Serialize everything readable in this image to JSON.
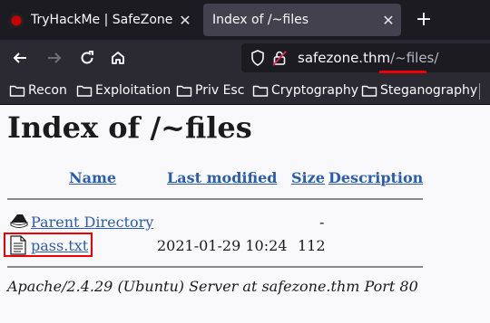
{
  "tabs": [
    {
      "title": "TryHackMe | SafeZone",
      "close": "✕",
      "active": false
    },
    {
      "title": "Index of /~files",
      "close": "✕",
      "active": true
    }
  ],
  "new_tab": "+",
  "toolbar": {
    "url_host": "safezone.thm",
    "url_path": "/~files/"
  },
  "bookmarks": [
    "Recon",
    "Exploitation",
    "Priv Esc",
    "Cryptography",
    "Steganography"
  ],
  "page": {
    "heading": "Index of /~files",
    "columns": {
      "name": "Name",
      "last_modified": "Last modified",
      "size": "Size",
      "description": "Description"
    },
    "rows": [
      {
        "name": "Parent Directory",
        "last_modified": "",
        "size": "-",
        "description": "",
        "icon": "back-icon"
      },
      {
        "name": "pass.txt",
        "last_modified": "2021-01-29 10:24",
        "size": "112",
        "description": "",
        "icon": "text-file-icon"
      }
    ],
    "footer": "Apache/2.4.29 (Ubuntu) Server at safezone.thm Port 80"
  },
  "colors": {
    "link": "#2a5db0",
    "highlight": "#e00000",
    "chrome_dark": "#1c1b22",
    "toolbar": "#2b2a33"
  }
}
